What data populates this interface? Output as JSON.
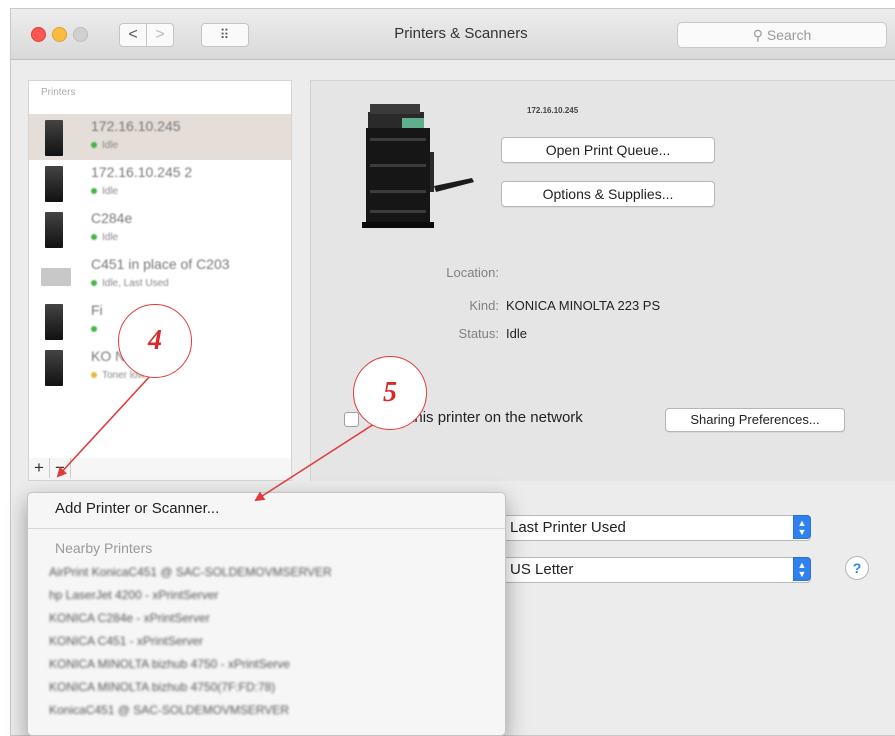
{
  "window": {
    "title": "Printers & Scanners",
    "search_placeholder": "Search",
    "nav": {
      "back_glyph": "<",
      "forward_glyph": ">",
      "grid_glyph": "⠿"
    }
  },
  "sidebar": {
    "heading": "Printers",
    "printers": [
      {
        "name": "172.16.10.245",
        "status": "Idle",
        "dot": "green"
      },
      {
        "name": "172.16.10.245 2",
        "status": "Idle",
        "dot": "green"
      },
      {
        "name": "C284e",
        "status": "Idle",
        "dot": "green"
      },
      {
        "name": "C451 in place of C203",
        "status": "Idle, Last Used",
        "dot": "green"
      },
      {
        "name": "Fi",
        "status": "",
        "dot": "green"
      },
      {
        "name": "KO NOLTA bi...",
        "status": "Toner low",
        "dot": "yellow"
      }
    ],
    "add_glyph": "+",
    "remove_glyph": "−"
  },
  "detail": {
    "printer_name": "172.16.10.245",
    "open_queue_label": "Open Print Queue...",
    "options_label": "Options & Supplies...",
    "location_label": "Location:",
    "location_value": "",
    "kind_label": "Kind:",
    "kind_value": "KONICA MINOLTA 223 PS",
    "status_label": "Status:",
    "status_value": "Idle",
    "share_label": "Share this printer on the network",
    "sharing_prefs_label": "Sharing Preferences..."
  },
  "defaults": {
    "default_printer_value": "Last Printer Used",
    "paper_size_value": "US Letter",
    "help_glyph": "?"
  },
  "menu": {
    "add_label": "Add Printer or Scanner...",
    "nearby_heading": "Nearby Printers",
    "nearby": [
      "AirPrint KonicaC451 @ SAC-SOLDEMOVMSERVER",
      "hp LaserJet 4200 - xPrintServer",
      "KONICA C284e - xPrintServer",
      "KONICA C451 - xPrintServer",
      "KONICA MINOLTA bizhub 4750 - xPrintServe",
      "KONICA MINOLTA bizhub 4750(7F:FD:78)",
      "KonicaC451 @ SAC-SOLDEMOVMSERVER"
    ]
  },
  "annotations": {
    "step_a": "4",
    "step_b": "5",
    "color": "#e23b3b"
  },
  "colors": {
    "accent": "#2f82ee",
    "selection": "#e4ddd8",
    "idle_dot": "#46b346",
    "warn_dot": "#e6b83a"
  }
}
